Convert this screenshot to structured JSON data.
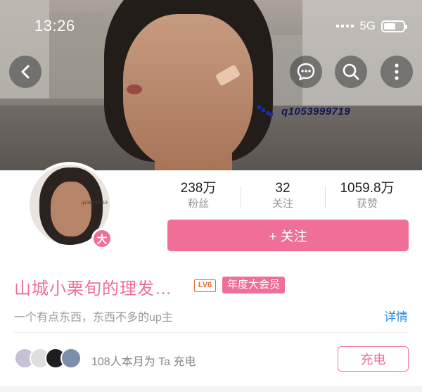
{
  "status_bar": {
    "time": "13:26",
    "network": "5G"
  },
  "banner": {
    "watermark": "q1053999719"
  },
  "icons": {
    "back": "chevron-left-icon",
    "chat": "chat-bubble-icon",
    "search": "search-icon",
    "more": "more-vertical-icon"
  },
  "profile": {
    "level_char": "大",
    "avatar_mark": "q1053999719",
    "stats": [
      {
        "value": "238万",
        "label": "粉丝"
      },
      {
        "value": "32",
        "label": "关注"
      },
      {
        "value": "1059.8万",
        "label": "获赞"
      }
    ],
    "follow_label": "+ 关注",
    "name": "山城小栗旬的理发…",
    "lv_badge": "LV6",
    "vip_badge": "年度大会员",
    "bio": "一个有点东西，东西不多的up主",
    "detail_label": "详情"
  },
  "charge": {
    "text": "108人本月为 Ta 充电",
    "button_label": "充电"
  },
  "colors": {
    "accent": "#f06f97",
    "link": "#2d8cdc",
    "lv": "#e86c28"
  }
}
